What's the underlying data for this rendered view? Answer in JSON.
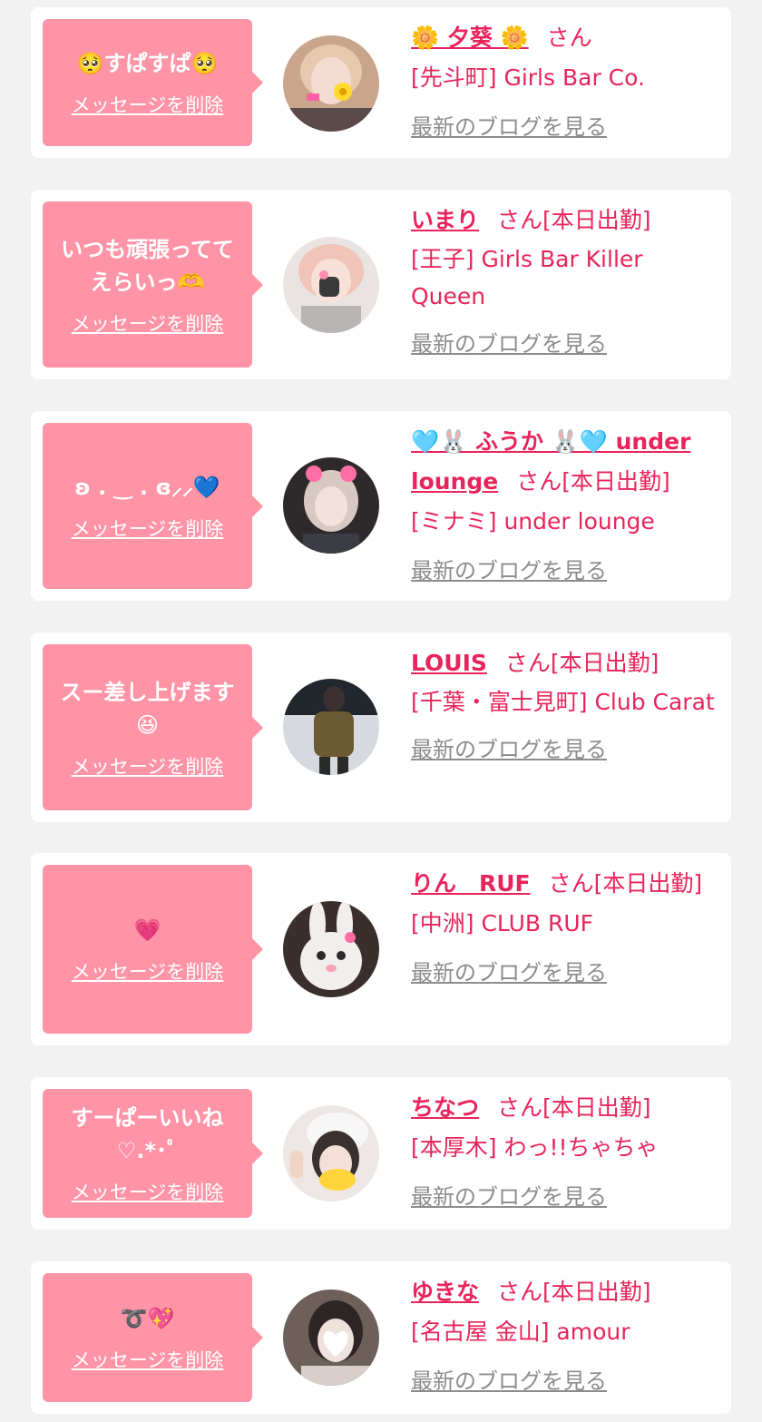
{
  "colors": {
    "page_bg": "#f2f2f2",
    "card_bg": "#ffffff",
    "bubble_bg": "#ff94a7",
    "accent": "#e8245c",
    "blog_link": "#8c8c8c"
  },
  "cards": [
    {
      "message": "🥺すぱすぱ🥺",
      "delete_label": "メッセージを削除",
      "name": "🌼 夕葵 🌼",
      "honorific": "さん",
      "status": "",
      "shop": "[先斗町] Girls Bar Co.",
      "blog_label": "最新のブログを見る"
    },
    {
      "message": "いつも頑張ってて\nえらいっ🫶",
      "delete_label": "メッセージを削除",
      "name": "いまり",
      "honorific": "さん",
      "status": "[本日出勤]",
      "shop": "[王子] Girls Bar Killer Queen",
      "blog_label": "最新のブログを見る"
    },
    {
      "message": "ʚ . ‿ . ɞ⸝⸝💙",
      "delete_label": "メッセージを削除",
      "name": "🩵🐰 ふうか 🐰🩵 under lounge",
      "honorific": "さん",
      "status": "[本日出勤]",
      "shop": "[ミナミ] under lounge",
      "blog_label": "最新のブログを見る"
    },
    {
      "message": "スー差し上げます\n😆",
      "delete_label": "メッセージを削除",
      "name": "LOUIS",
      "honorific": "さん",
      "status": "[本日出勤]",
      "shop": "[千葉・富士見町] Club Carat",
      "blog_label": "最新のブログを見る"
    },
    {
      "message": "💗",
      "delete_label": "メッセージを削除",
      "name": "りん　RUF",
      "honorific": "さん",
      "status": "[本日出勤]",
      "shop": "[中洲] CLUB RUF",
      "blog_label": "最新のブログを見る"
    },
    {
      "message": "すーぱーいいね\n♡.*･ﾟ",
      "delete_label": "メッセージを削除",
      "name": "ちなつ",
      "honorific": "さん",
      "status": "[本日出勤]",
      "shop": "[本厚木] わっ!!ちゃちゃ",
      "blog_label": "最新のブログを見る"
    },
    {
      "message": "➰💖",
      "delete_label": "メッセージを削除",
      "name": "ゆきな",
      "honorific": "さん",
      "status": "[本日出勤]",
      "shop": "[名古屋 金山] amour",
      "blog_label": "最新のブログを見る"
    }
  ]
}
